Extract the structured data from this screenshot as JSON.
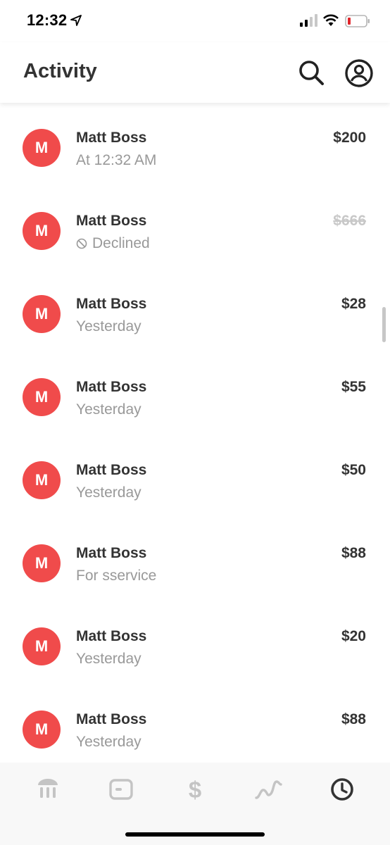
{
  "status_bar": {
    "time": "12:32"
  },
  "header": {
    "title": "Activity"
  },
  "transactions": [
    {
      "initial": "M",
      "name": "Matt Boss",
      "subtitle": "At 12:32 AM",
      "amount": "$200",
      "declined": false
    },
    {
      "initial": "M",
      "name": "Matt Boss",
      "subtitle": "Declined",
      "amount": "$666",
      "declined": true
    },
    {
      "initial": "M",
      "name": "Matt Boss",
      "subtitle": "Yesterday",
      "amount": "$28",
      "declined": false
    },
    {
      "initial": "M",
      "name": "Matt Boss",
      "subtitle": "Yesterday",
      "amount": "$55",
      "declined": false
    },
    {
      "initial": "M",
      "name": "Matt Boss",
      "subtitle": "Yesterday",
      "amount": "$50",
      "declined": false
    },
    {
      "initial": "M",
      "name": "Matt Boss",
      "subtitle": "For sservice",
      "amount": "$88",
      "declined": false
    },
    {
      "initial": "M",
      "name": "Matt Boss",
      "subtitle": "Yesterday",
      "amount": "$20",
      "declined": false
    },
    {
      "initial": "M",
      "name": "Matt Boss",
      "subtitle": "Yesterday",
      "amount": "$88",
      "declined": false
    }
  ],
  "bottom_nav": [
    {
      "icon": "bank-icon",
      "active": false
    },
    {
      "icon": "card-icon",
      "active": false
    },
    {
      "icon": "dollar-icon",
      "active": false
    },
    {
      "icon": "investing-icon",
      "active": false
    },
    {
      "icon": "clock-icon",
      "active": true
    }
  ],
  "colors": {
    "avatar": "#f04b4b",
    "text_primary": "#333333",
    "text_secondary": "#999999",
    "declined_amount": "#c8c8c8",
    "nav_inactive": "#c4c4c4",
    "nav_active": "#333333"
  }
}
